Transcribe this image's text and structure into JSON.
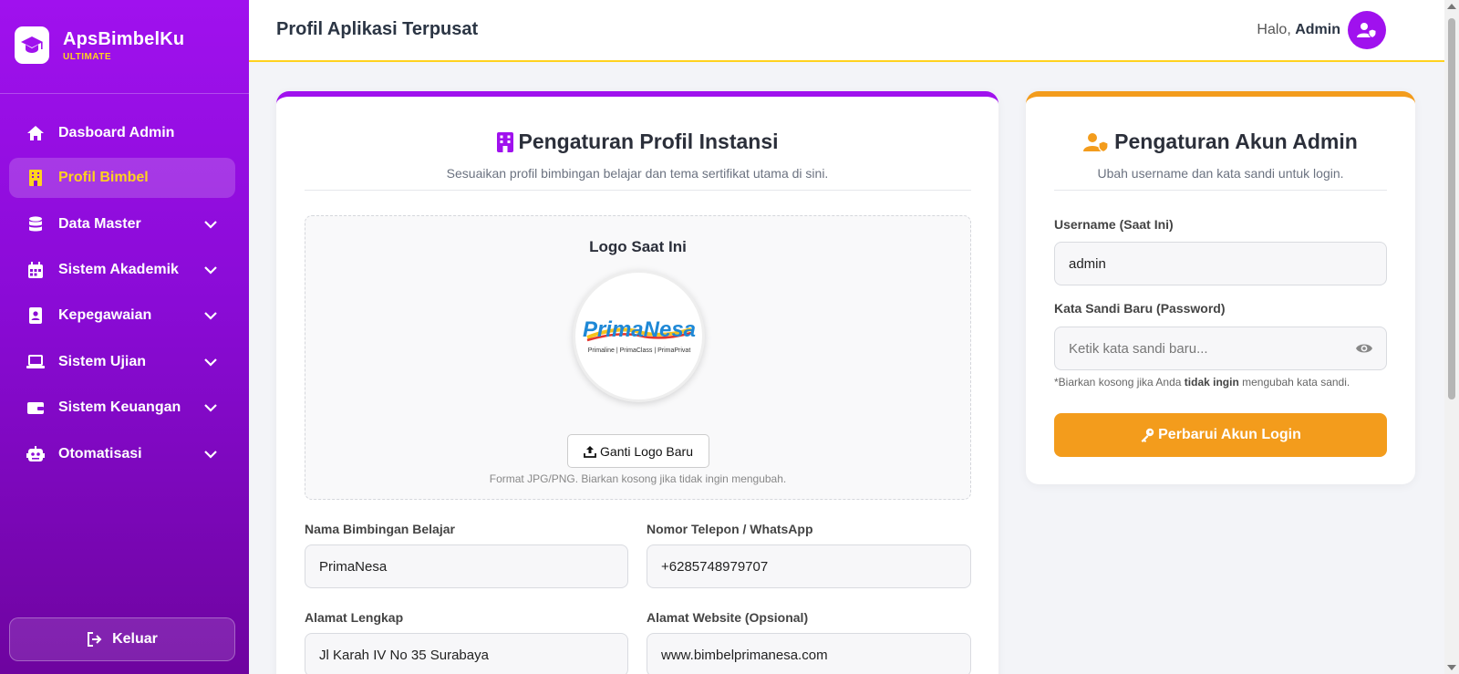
{
  "brand": {
    "name": "ApsBimbelKu",
    "tagline": "ULTIMATE"
  },
  "sidebar": {
    "items": [
      {
        "label": "Dasboard Admin",
        "icon": "home-icon",
        "active": false
      },
      {
        "label": "Profil Bimbel",
        "icon": "building-icon",
        "active": true
      },
      {
        "label": "Data Master",
        "icon": "database-icon",
        "expandable": true
      },
      {
        "label": "Sistem Akademik",
        "icon": "calendar-icon",
        "expandable": true
      },
      {
        "label": "Kepegawaian",
        "icon": "id-badge-icon",
        "expandable": true
      },
      {
        "label": "Sistem Ujian",
        "icon": "laptop-icon",
        "expandable": true
      },
      {
        "label": "Sistem Keuangan",
        "icon": "wallet-icon",
        "expandable": true
      },
      {
        "label": "Otomatisasi",
        "icon": "robot-icon",
        "expandable": true
      }
    ],
    "logout_label": "Keluar"
  },
  "header": {
    "title": "Profil Aplikasi Terpusat",
    "greeting": "Halo,",
    "user": "Admin"
  },
  "profile_card": {
    "title": "Pengaturan Profil Instansi",
    "subtitle": "Sesuaikan profil bimbingan belajar dan tema sertifikat utama di sini.",
    "logo_title": "Logo Saat Ini",
    "logo_text": "PrimaNesa",
    "logo_caption": "Primaline | PrimaClass | PrimaPrivat",
    "upload_label": "Ganti Logo Baru",
    "upload_hint": "Format JPG/PNG. Biarkan kosong jika tidak ingin mengubah.",
    "fields": {
      "name_label": "Nama Bimbingan Belajar",
      "name_value": "PrimaNesa",
      "phone_label": "Nomor Telepon / WhatsApp",
      "phone_value": "+6285748979707",
      "address_label": "Alamat Lengkap",
      "address_value": "Jl Karah IV No 35 Surabaya",
      "website_label": "Alamat Website (Opsional)",
      "website_value": "www.bimbelprimanesa.com"
    }
  },
  "account_card": {
    "title": "Pengaturan Akun Admin",
    "subtitle": "Ubah username dan kata sandi untuk login.",
    "username_label": "Username (Saat Ini)",
    "username_value": "admin",
    "password_label": "Kata Sandi Baru (Password)",
    "password_placeholder": "Ketik kata sandi baru...",
    "hint_prefix": "*Biarkan kosong jika Anda",
    "hint_bold": "tidak ingin",
    "hint_suffix": "mengubah kata sandi.",
    "submit_label": "Perbarui Akun Login"
  },
  "colors": {
    "primary": "#a011ee",
    "accent": "#ffd21f",
    "orange": "#f39c1c"
  }
}
